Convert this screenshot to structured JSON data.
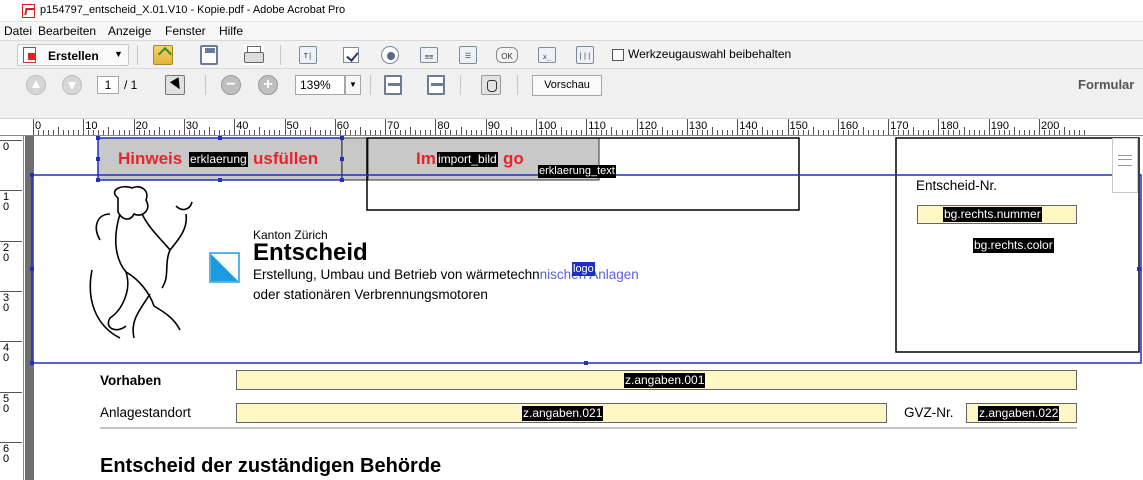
{
  "window": {
    "title": "p154797_entscheid_X.01.V10 - Kopie.pdf - Adobe Acrobat Pro"
  },
  "menu": [
    "Datei",
    "Bearbeiten",
    "Anzeige",
    "Fenster",
    "Hilfe"
  ],
  "toolbar": {
    "create_label": "Erstellen",
    "keep_tool_label": "Werkzeugauswahl beibehalten",
    "ok_label": "OK"
  },
  "nav": {
    "current_page": "1",
    "total_pages": "/ 1",
    "zoom": "139%",
    "preview_label": "Vorschau",
    "mode_label": "Formular"
  },
  "ruler": {
    "labels": [
      "0",
      "10",
      "20",
      "30",
      "40",
      "50",
      "60",
      "70",
      "80",
      "90",
      "100",
      "110",
      "120",
      "130",
      "140",
      "150",
      "160",
      "170",
      "180",
      "190",
      "200"
    ],
    "vlabels": [
      "0",
      "1\n0",
      "2\n0",
      "3\n0",
      "4\n0",
      "5\n0",
      "6\n0"
    ]
  },
  "form": {
    "hint_part1": "Hinweis",
    "hint_field": "erklaerung",
    "hint_part2": "usfüllen",
    "import_part1": "Im",
    "import_field": "import_bild",
    "import_part2": "go",
    "explain_field": "erklaerung_text",
    "logo_field": "logo",
    "decision_nr_label": "Entscheid-Nr.",
    "rechts_nummer_field": "bg.rechts.nummer",
    "rechts_color_field": "bg.rechts.color",
    "kanton": "Kanton Zürich",
    "doc_title": "Entscheid",
    "doc_subtitle_1_a": "Erstellung, Umbau und Betrieb von wärmetechn",
    "doc_subtitle_1_b": "schen Anlagen",
    "doc_subtitle_2": "oder stationären Verbrennungsmotoren",
    "vorhaben_label": "Vorhaben",
    "vorhaben_field": "z.angaben.001",
    "standort_label": "Anlagestandort",
    "standort_field": "z.angaben.021",
    "gvz_label": "GVZ-Nr.",
    "gvz_field": "z.angaben.022",
    "section_heading": "Entscheid der zuständigen Behörde"
  },
  "colors": {
    "field_fill": "#fff7c4",
    "hint_red": "#e8242b",
    "selection_blue": "#1f2fbf"
  }
}
